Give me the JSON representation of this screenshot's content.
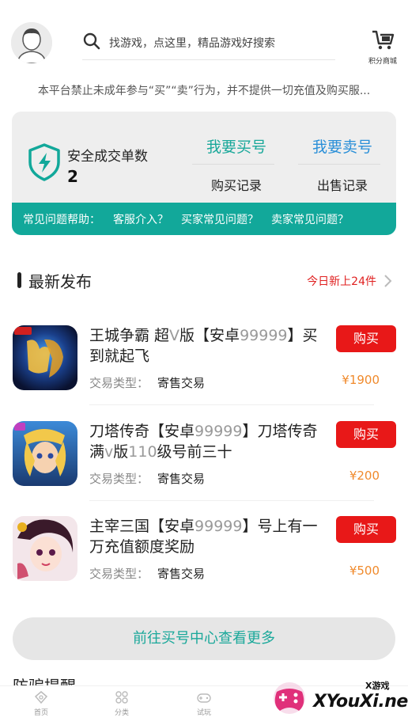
{
  "header": {
    "search_placeholder": "找游戏，点这里，精品游戏好搜索",
    "shop_label": "积分商城"
  },
  "notice": "本平台禁止未成年参与“买”“卖”行为，并不提供一切充值及购买服...",
  "panel": {
    "safe_label": "安全成交单数",
    "safe_count": "2",
    "buy_account": "我要买号",
    "sell_account": "我要卖号",
    "buy_records": "购买记录",
    "sell_records": "出售记录",
    "faq_title": "常见问题帮助：",
    "faq_links": [
      "客服介入？",
      "买家常见问题？",
      "卖家常见问题？"
    ]
  },
  "section": {
    "title": "最新发布",
    "today": "今日新上24件"
  },
  "listings": [
    {
      "name_a": "王城争霸 超",
      "name_dim1": "V",
      "name_b": "版【安卓",
      "name_dim2": "99999",
      "name_c": "】买到就起飞",
      "type_label": "交易类型：",
      "type_value": "寄售交易",
      "buy_label": "购买",
      "price": "¥1900"
    },
    {
      "name_a": "刀塔传奇【安卓",
      "name_dim1": "99999",
      "name_b": "】刀塔传奇满",
      "name_dim2": "v",
      "name_c": "版",
      "name_dim3": "110",
      "name_d": "级号前三十",
      "type_label": "交易类型：",
      "type_value": "寄售交易",
      "buy_label": "购买",
      "price": "¥200"
    },
    {
      "name_a": "主宰三国【安卓",
      "name_dim1": "99999",
      "name_b": "】号上有一万充值额度奖励",
      "type_label": "交易类型：",
      "type_value": "寄售交易",
      "buy_label": "购买",
      "price": "¥500"
    }
  ],
  "more_button": "前往买号中心查看更多",
  "next_section": "防骗提醒",
  "tabs": [
    {
      "label": "首页",
      "icon": "home-icon"
    },
    {
      "label": "分类",
      "icon": "category-icon"
    },
    {
      "label": "试玩",
      "icon": "gamepad-icon"
    }
  ],
  "watermark": {
    "sub": "X游戏",
    "main": "XYouXi.net"
  },
  "colors": {
    "teal": "#12a89a",
    "blue": "#2a8fd8",
    "red": "#e81818",
    "orange": "#f08a2c"
  }
}
